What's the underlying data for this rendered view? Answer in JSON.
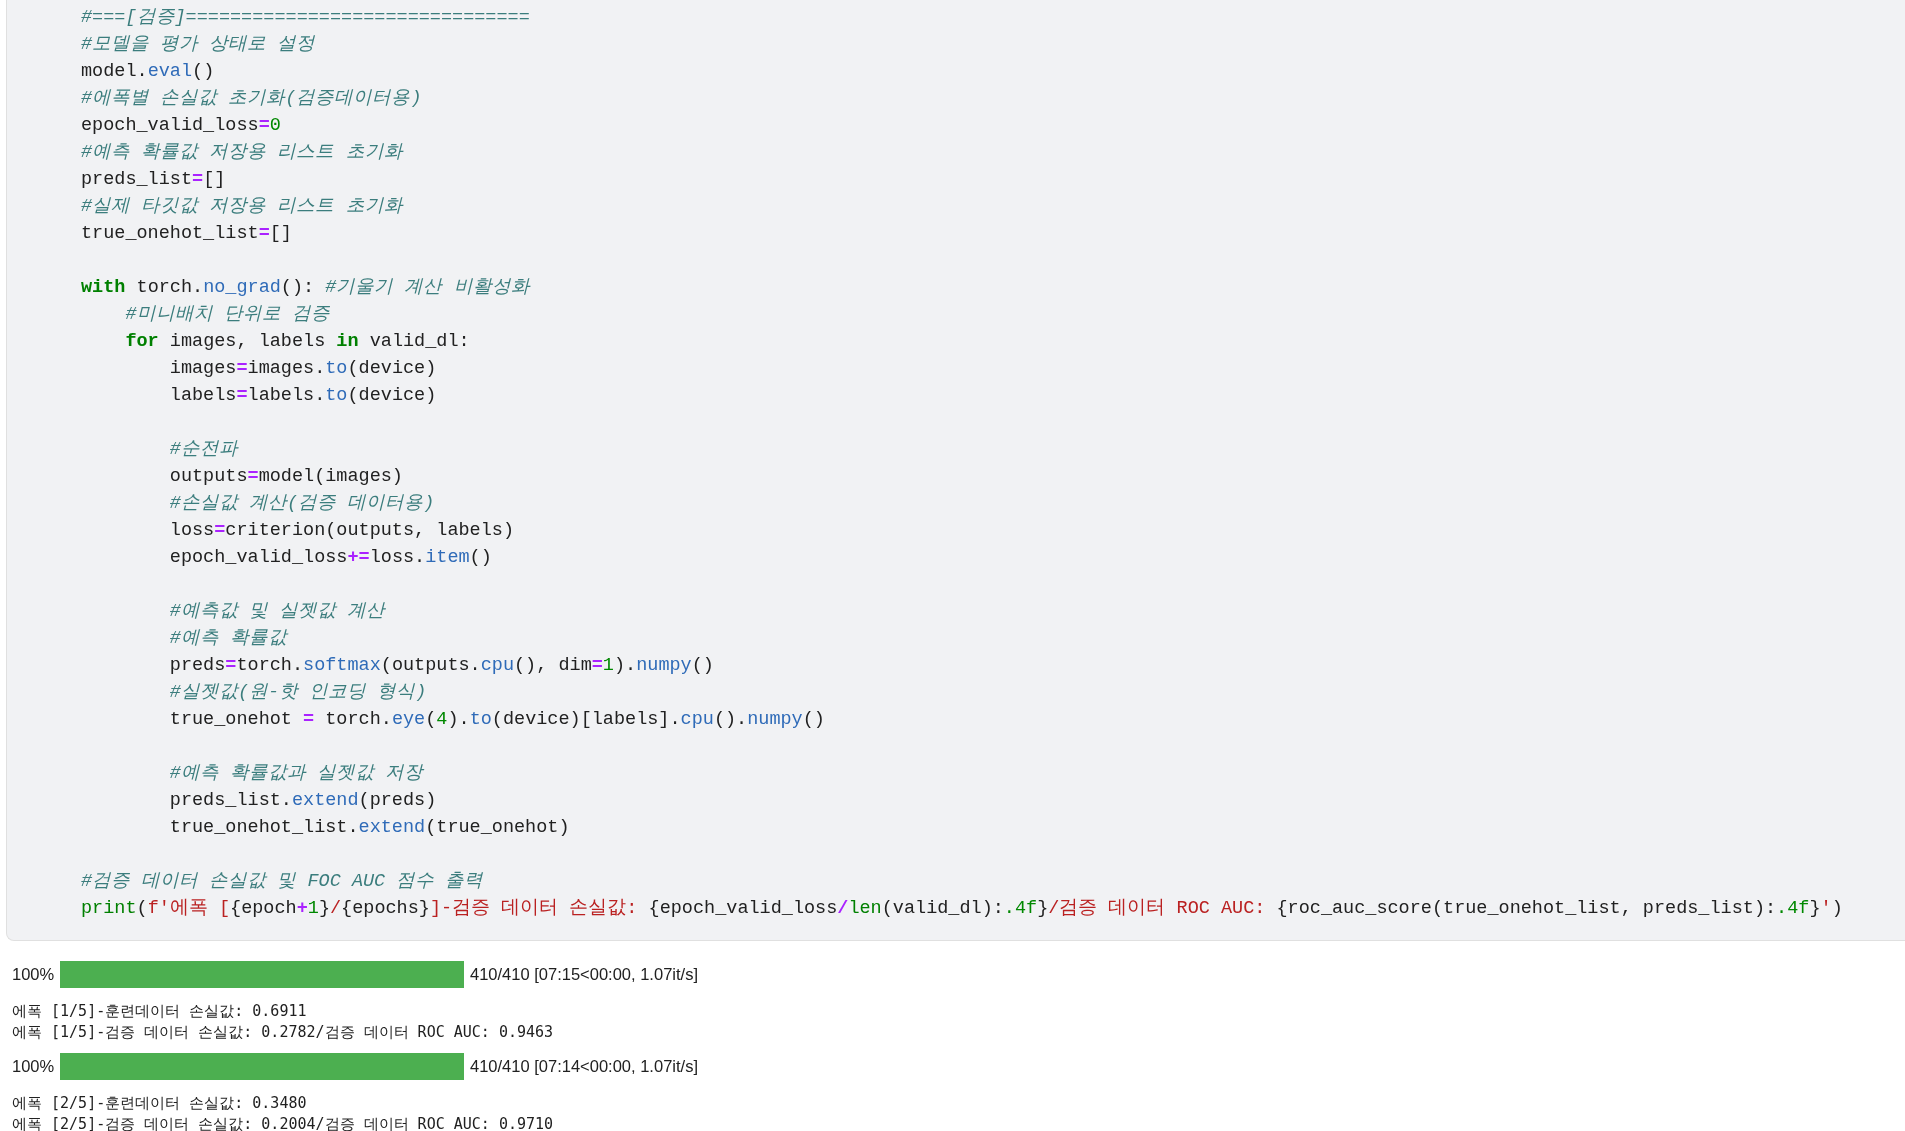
{
  "code_cell": {
    "lines": [
      {
        "kind": "code",
        "tokens": [
          {
            "kind": "comment",
            "text": "#===[검증]==============================="
          }
        ]
      },
      {
        "kind": "code",
        "tokens": [
          {
            "kind": "comment",
            "text": "#모델을 평가 상태로 설정"
          }
        ]
      },
      {
        "kind": "code",
        "tokens": [
          {
            "kind": "plain",
            "text": "model."
          },
          {
            "kind": "func",
            "text": "eval"
          },
          {
            "kind": "plain",
            "text": "()"
          }
        ]
      },
      {
        "kind": "code",
        "tokens": [
          {
            "kind": "comment",
            "text": "#에폭별 손실값 초기화(검증데이터용)"
          }
        ]
      },
      {
        "kind": "code",
        "tokens": [
          {
            "kind": "plain",
            "text": "epoch_valid_loss"
          },
          {
            "kind": "op",
            "text": "="
          },
          {
            "kind": "number",
            "text": "0"
          }
        ]
      },
      {
        "kind": "code",
        "tokens": [
          {
            "kind": "comment",
            "text": "#예측 확률값 저장용 리스트 초기화"
          }
        ]
      },
      {
        "kind": "code",
        "tokens": [
          {
            "kind": "plain",
            "text": "preds_list"
          },
          {
            "kind": "op",
            "text": "="
          },
          {
            "kind": "plain",
            "text": "[]"
          }
        ]
      },
      {
        "kind": "code",
        "tokens": [
          {
            "kind": "comment",
            "text": "#실제 타깃값 저장용 리스트 초기화"
          }
        ]
      },
      {
        "kind": "code",
        "tokens": [
          {
            "kind": "plain",
            "text": "true_onehot_list"
          },
          {
            "kind": "op",
            "text": "="
          },
          {
            "kind": "plain",
            "text": "[]"
          }
        ]
      },
      {
        "kind": "blank"
      },
      {
        "kind": "code",
        "tokens": [
          {
            "kind": "keyword",
            "text": "with"
          },
          {
            "kind": "plain",
            "text": " torch."
          },
          {
            "kind": "func",
            "text": "no_grad"
          },
          {
            "kind": "plain",
            "text": "(): "
          },
          {
            "kind": "comment",
            "text": "#기울기 계산 비활성화"
          }
        ]
      },
      {
        "kind": "code",
        "tokens": [
          {
            "kind": "comment",
            "text": "    #미니배치 단위로 검증"
          }
        ]
      },
      {
        "kind": "code",
        "tokens": [
          {
            "kind": "keyword",
            "text": "    for"
          },
          {
            "kind": "plain",
            "text": " images, labels "
          },
          {
            "kind": "keyword",
            "text": "in"
          },
          {
            "kind": "plain",
            "text": " valid_dl:"
          }
        ]
      },
      {
        "kind": "code",
        "tokens": [
          {
            "kind": "plain",
            "text": "        images"
          },
          {
            "kind": "op",
            "text": "="
          },
          {
            "kind": "plain",
            "text": "images."
          },
          {
            "kind": "func",
            "text": "to"
          },
          {
            "kind": "plain",
            "text": "(device)"
          }
        ]
      },
      {
        "kind": "code",
        "tokens": [
          {
            "kind": "plain",
            "text": "        labels"
          },
          {
            "kind": "op",
            "text": "="
          },
          {
            "kind": "plain",
            "text": "labels."
          },
          {
            "kind": "func",
            "text": "to"
          },
          {
            "kind": "plain",
            "text": "(device)"
          }
        ]
      },
      {
        "kind": "blank"
      },
      {
        "kind": "code",
        "tokens": [
          {
            "kind": "comment",
            "text": "        #순전파"
          }
        ]
      },
      {
        "kind": "code",
        "tokens": [
          {
            "kind": "plain",
            "text": "        outputs"
          },
          {
            "kind": "op",
            "text": "="
          },
          {
            "kind": "plain",
            "text": "model(images)"
          }
        ]
      },
      {
        "kind": "code",
        "tokens": [
          {
            "kind": "comment",
            "text": "        #손실값 계산(검증 데이터용)"
          }
        ]
      },
      {
        "kind": "code",
        "tokens": [
          {
            "kind": "plain",
            "text": "        loss"
          },
          {
            "kind": "op",
            "text": "="
          },
          {
            "kind": "plain",
            "text": "criterion(outputs, labels)"
          }
        ]
      },
      {
        "kind": "code",
        "tokens": [
          {
            "kind": "plain",
            "text": "        epoch_valid_loss"
          },
          {
            "kind": "op",
            "text": "+="
          },
          {
            "kind": "plain",
            "text": "loss."
          },
          {
            "kind": "func",
            "text": "item"
          },
          {
            "kind": "plain",
            "text": "()"
          }
        ]
      },
      {
        "kind": "blank"
      },
      {
        "kind": "code",
        "tokens": [
          {
            "kind": "comment",
            "text": "        #예측값 및 실젯값 계산"
          }
        ]
      },
      {
        "kind": "code",
        "tokens": [
          {
            "kind": "comment",
            "text": "        #예측 확률값"
          }
        ]
      },
      {
        "kind": "code",
        "tokens": [
          {
            "kind": "plain",
            "text": "        preds"
          },
          {
            "kind": "op",
            "text": "="
          },
          {
            "kind": "plain",
            "text": "torch."
          },
          {
            "kind": "func",
            "text": "softmax"
          },
          {
            "kind": "plain",
            "text": "(outputs."
          },
          {
            "kind": "func",
            "text": "cpu"
          },
          {
            "kind": "plain",
            "text": "(), dim"
          },
          {
            "kind": "op",
            "text": "="
          },
          {
            "kind": "number",
            "text": "1"
          },
          {
            "kind": "plain",
            "text": ")."
          },
          {
            "kind": "func",
            "text": "numpy"
          },
          {
            "kind": "plain",
            "text": "()"
          }
        ]
      },
      {
        "kind": "code",
        "tokens": [
          {
            "kind": "comment",
            "text": "        #실젯값(원-핫 인코딩 형식)"
          }
        ]
      },
      {
        "kind": "code",
        "tokens": [
          {
            "kind": "plain",
            "text": "        true_onehot "
          },
          {
            "kind": "op",
            "text": "="
          },
          {
            "kind": "plain",
            "text": " torch."
          },
          {
            "kind": "func",
            "text": "eye"
          },
          {
            "kind": "plain",
            "text": "("
          },
          {
            "kind": "number",
            "text": "4"
          },
          {
            "kind": "plain",
            "text": ")."
          },
          {
            "kind": "func",
            "text": "to"
          },
          {
            "kind": "plain",
            "text": "(device)[labels]."
          },
          {
            "kind": "func",
            "text": "cpu"
          },
          {
            "kind": "plain",
            "text": "()."
          },
          {
            "kind": "func",
            "text": "numpy"
          },
          {
            "kind": "plain",
            "text": "()"
          }
        ]
      },
      {
        "kind": "blank"
      },
      {
        "kind": "code",
        "tokens": [
          {
            "kind": "comment",
            "text": "        #예측 확률값과 실젯값 저장"
          }
        ]
      },
      {
        "kind": "code",
        "tokens": [
          {
            "kind": "plain",
            "text": "        preds_list."
          },
          {
            "kind": "func",
            "text": "extend"
          },
          {
            "kind": "plain",
            "text": "(preds)"
          }
        ]
      },
      {
        "kind": "code",
        "tokens": [
          {
            "kind": "plain",
            "text": "        true_onehot_list."
          },
          {
            "kind": "func",
            "text": "extend"
          },
          {
            "kind": "plain",
            "text": "(true_onehot)"
          }
        ]
      },
      {
        "kind": "blank"
      },
      {
        "kind": "code",
        "tokens": [
          {
            "kind": "comment",
            "text": "#검증 데이터 손실값 및 FOC AUC 점수 출력"
          }
        ]
      },
      {
        "kind": "code",
        "tokens": [
          {
            "kind": "builtin",
            "text": "print"
          },
          {
            "kind": "plain",
            "text": "("
          },
          {
            "kind": "string",
            "text": "f'에폭 ["
          },
          {
            "kind": "plain",
            "text": "{epoch"
          },
          {
            "kind": "op",
            "text": "+"
          },
          {
            "kind": "number",
            "text": "1"
          },
          {
            "kind": "plain",
            "text": "}"
          },
          {
            "kind": "string",
            "text": "/"
          },
          {
            "kind": "plain",
            "text": "{epochs}"
          },
          {
            "kind": "string",
            "text": "]-검증 데이터 손실값: "
          },
          {
            "kind": "plain",
            "text": "{epoch_valid_loss"
          },
          {
            "kind": "op",
            "text": "/"
          },
          {
            "kind": "builtin",
            "text": "len"
          },
          {
            "kind": "plain",
            "text": "(valid_dl):"
          },
          {
            "kind": "number",
            "text": ".4f"
          },
          {
            "kind": "plain",
            "text": "}"
          },
          {
            "kind": "string",
            "text": "/검증 데이터 ROC AUC: "
          },
          {
            "kind": "plain",
            "text": "{roc_auc_score(true_onehot_list, preds_list):"
          },
          {
            "kind": "number",
            "text": ".4f"
          },
          {
            "kind": "plain",
            "text": "}"
          },
          {
            "kind": "string",
            "text": "'"
          },
          {
            "kind": "plain",
            "text": ")"
          }
        ]
      }
    ]
  },
  "output": [
    {
      "kind": "progress",
      "percent": "100%",
      "level": 1,
      "status": "410/410 [07:15<00:00, 1.07it/s]"
    },
    {
      "kind": "text",
      "lines": [
        "에폭 [1/5]-훈련데이터 손실값: 0.6911",
        "에폭 [1/5]-검증 데이터 손실값: 0.2782/검증 데이터 ROC AUC: 0.9463"
      ]
    },
    {
      "kind": "progress",
      "percent": "100%",
      "level": 1,
      "status": "410/410 [07:14<00:00, 1.07it/s]"
    },
    {
      "kind": "text",
      "lines": [
        "에폭 [2/5]-훈련데이터 손실값: 0.3480",
        "에폭 [2/5]-검증 데이터 손실값: 0.2004/검증 데이터 ROC AUC: 0.9710"
      ]
    }
  ]
}
